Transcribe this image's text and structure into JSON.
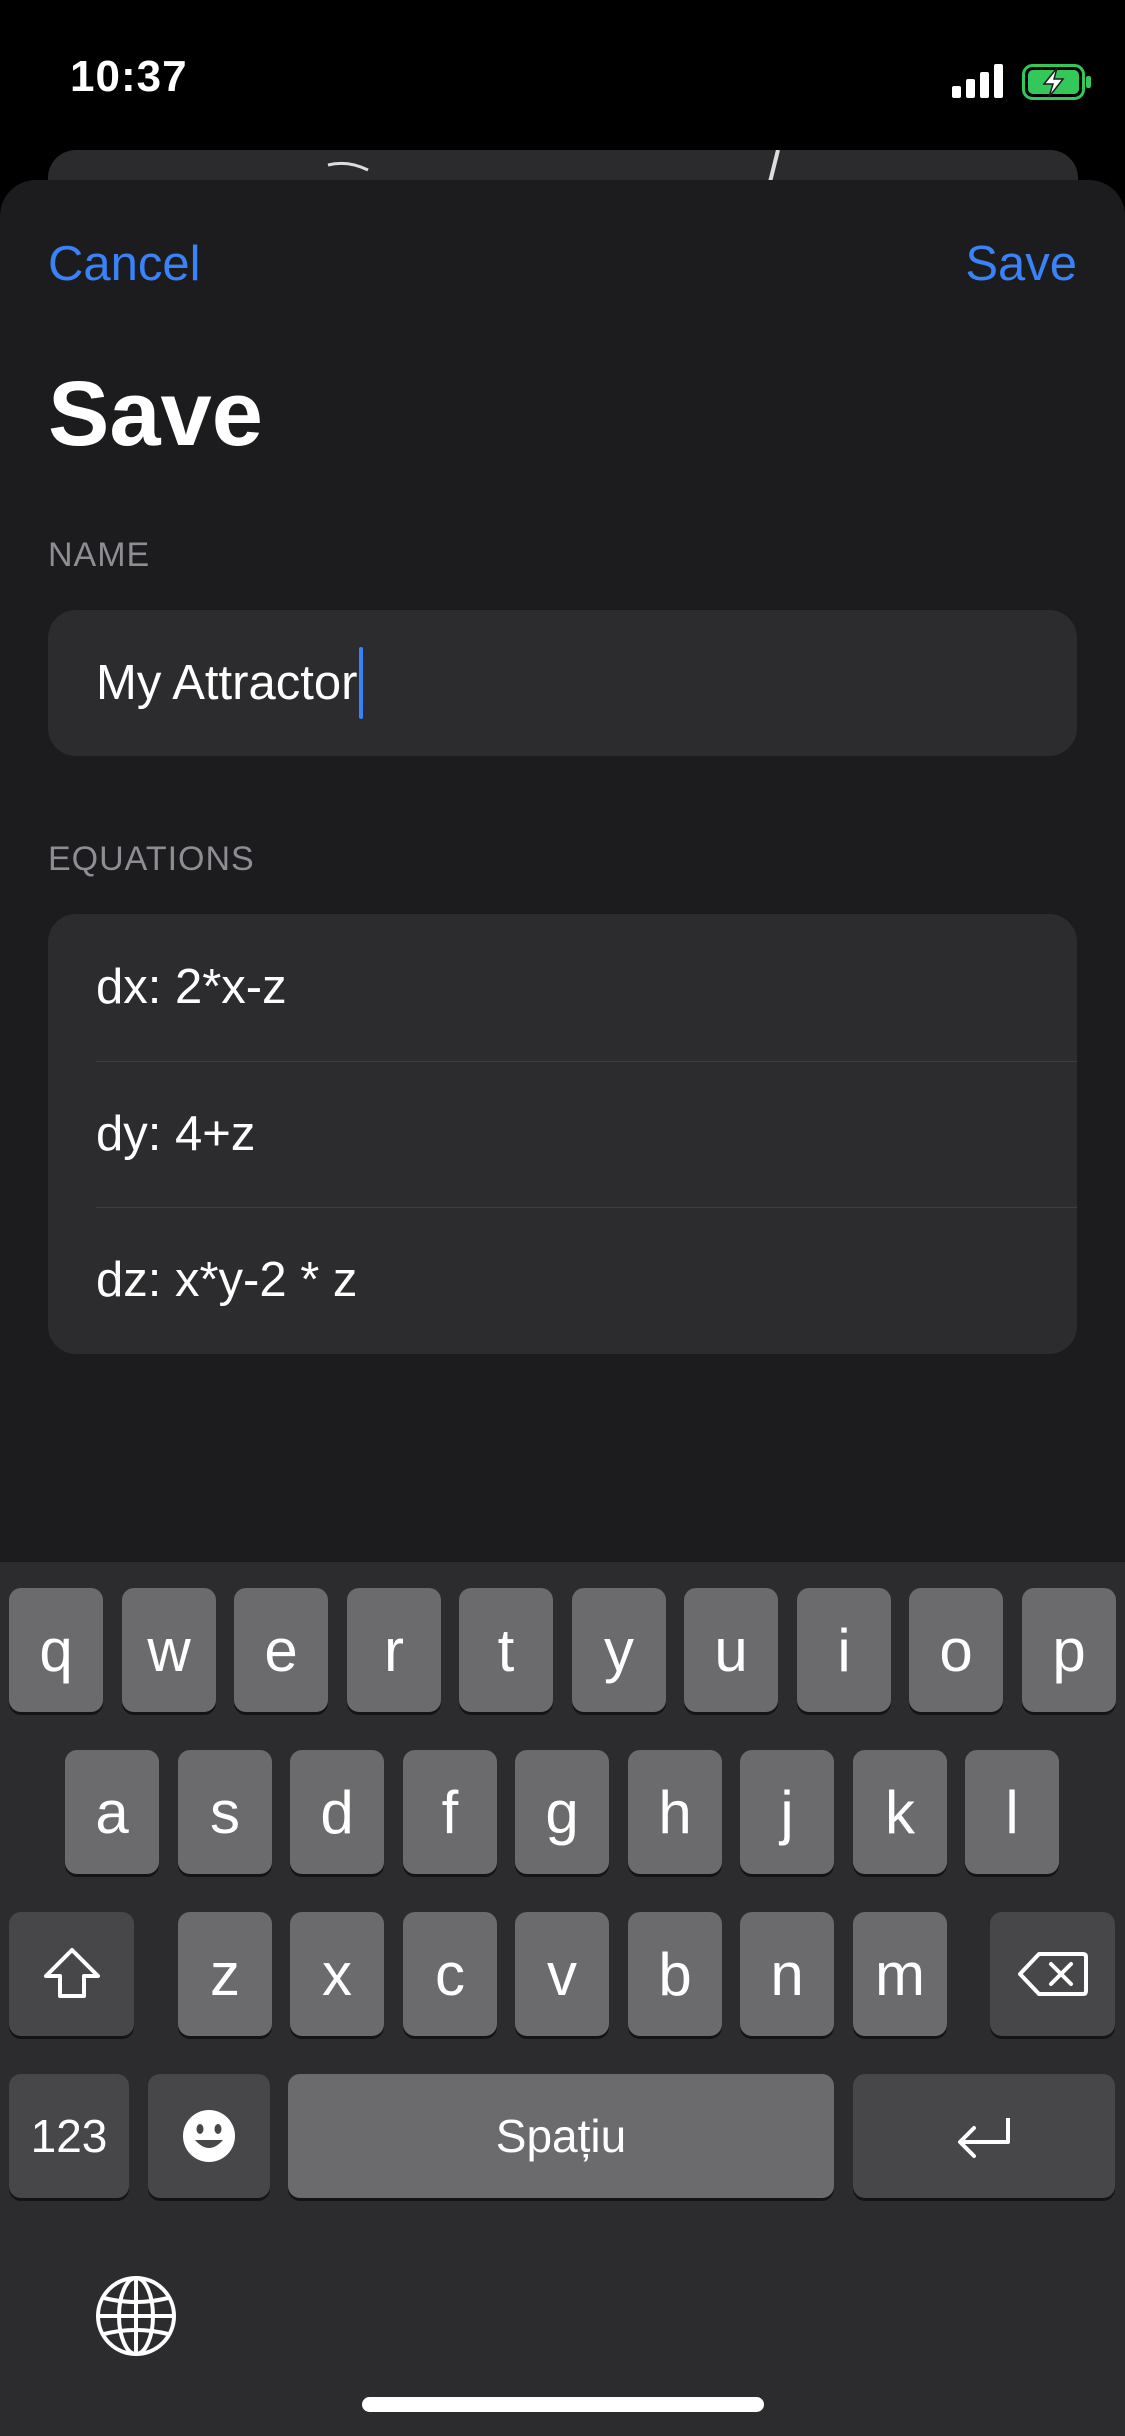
{
  "status_bar": {
    "time": "10:37"
  },
  "sheet": {
    "cancel_label": "Cancel",
    "save_label": "Save",
    "title": "Save",
    "name_section": {
      "label": "NAME",
      "value": "My Attractor"
    },
    "equations_section": {
      "label": "EQUATIONS",
      "rows": [
        "dx: 2*x-z",
        "dy: 4+z",
        "dz: x*y-2 * z"
      ]
    }
  },
  "keyboard": {
    "row1": [
      "q",
      "w",
      "e",
      "r",
      "t",
      "y",
      "u",
      "i",
      "o",
      "p"
    ],
    "row2": [
      "a",
      "s",
      "d",
      "f",
      "g",
      "h",
      "j",
      "k",
      "l"
    ],
    "row3": [
      "z",
      "x",
      "c",
      "v",
      "b",
      "n",
      "m"
    ],
    "numbers_label": "123",
    "space_label": "Spațiu"
  },
  "colors": {
    "accent": "#3a82f7",
    "sheet_bg": "#1c1c1e",
    "field_bg": "#2c2c2e",
    "battery_green": "#34c759"
  }
}
